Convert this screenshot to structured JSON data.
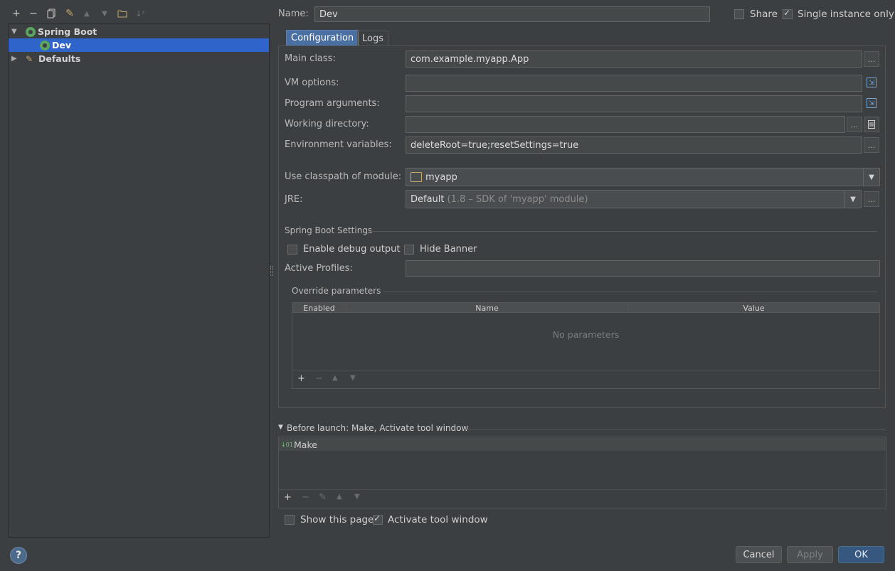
{
  "toolbar": {
    "icons": [
      "plus-icon",
      "minus-icon",
      "copy-icon",
      "wrench-icon",
      "arrow-up-icon",
      "arrow-down-icon",
      "folder-icon",
      "sort-icon"
    ]
  },
  "tree": {
    "group_label": "Spring Boot",
    "item_label": "Dev",
    "defaults_label": "Defaults"
  },
  "header": {
    "name_label": "Name:",
    "name_value": "Dev",
    "share_label": "Share",
    "single_instance_label": "Single instance only"
  },
  "tabs": [
    "Configuration",
    "Logs"
  ],
  "form": {
    "main_class_label": "Main class:",
    "main_class_value": "com.example.myapp.App",
    "vm_options_label": "VM options:",
    "program_args_label": "Program arguments:",
    "working_dir_label": "Working directory:",
    "env_vars_label": "Environment variables:",
    "env_vars_value": "deleteRoot=true;resetSettings=true",
    "classpath_label": "Use classpath of module:",
    "classpath_value": "myapp",
    "jre_label": "JRE:",
    "jre_value": "Default",
    "jre_hint": "(1.8 – SDK of 'myapp' module)",
    "ellipsis": "..."
  },
  "spring": {
    "section_title": "Spring Boot Settings",
    "debug_label": "Enable debug output",
    "hide_banner_label": "Hide Banner",
    "profiles_label": "Active Profiles:"
  },
  "override": {
    "title": "Override parameters",
    "columns": [
      "Enabled",
      "Name",
      "Value"
    ],
    "empty_text": "No parameters",
    "toolbar": [
      "+",
      "−",
      "▲",
      "▼"
    ]
  },
  "before_launch": {
    "title": "Before launch: Make, Activate tool window",
    "item": "Make",
    "toolbar": [
      "+",
      "−",
      "✎",
      "▲",
      "▼"
    ]
  },
  "footer": {
    "show_page_label": "Show this page",
    "activate_label": "Activate tool window",
    "help": "?",
    "cancel": "Cancel",
    "apply": "Apply",
    "ok": "OK"
  },
  "colors": {
    "background": "#3c3f41",
    "selection": "#2f65ca",
    "primary_button": "#365880",
    "spring_green": "#5ba35f"
  }
}
